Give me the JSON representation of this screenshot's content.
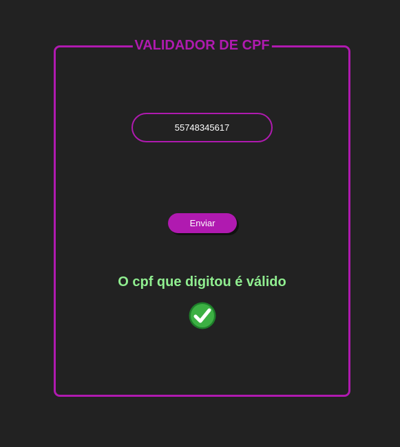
{
  "app": {
    "title": "VALIDADOR DE CPF"
  },
  "form": {
    "cpf_value": "55748345617",
    "submit_label": "Enviar"
  },
  "result": {
    "message": "O cpf que digitou é válido",
    "icon": "check-circle-icon",
    "status": "valid"
  },
  "colors": {
    "background": "#222222",
    "accent": "#b01ab0",
    "success_text": "#90ee90",
    "success_icon": "#3cb043",
    "button_text": "#ffffff"
  }
}
